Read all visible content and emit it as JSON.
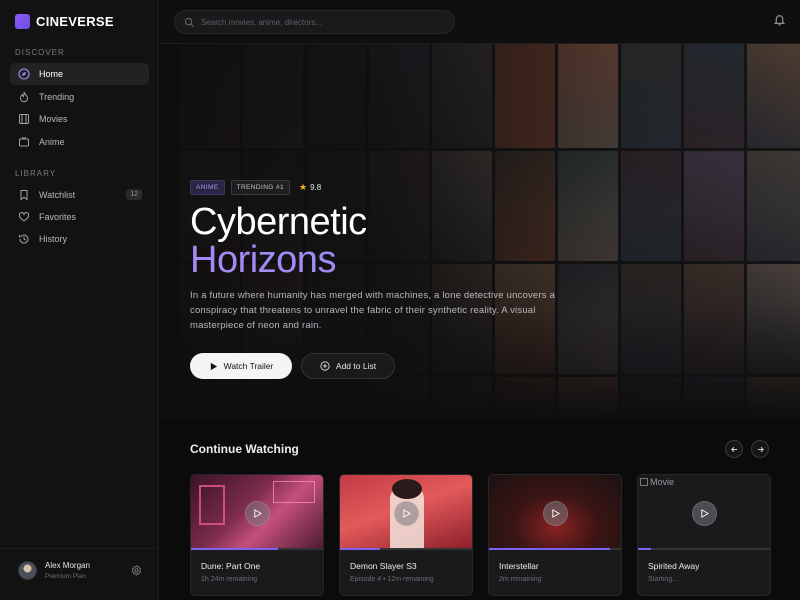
{
  "app": {
    "name": "CINEVERSE",
    "accent": "#8b5cf6"
  },
  "sidebar": {
    "discover_label": "DISCOVER",
    "library_label": "LIBRARY",
    "discover": [
      {
        "label": "Home",
        "icon": "compass-icon",
        "active": true
      },
      {
        "label": "Trending",
        "icon": "flame-icon"
      },
      {
        "label": "Movies",
        "icon": "film-icon"
      },
      {
        "label": "Anime",
        "icon": "tv-icon"
      }
    ],
    "library": [
      {
        "label": "Watchlist",
        "icon": "bookmark-icon",
        "badge": "12"
      },
      {
        "label": "Favorites",
        "icon": "heart-icon"
      },
      {
        "label": "History",
        "icon": "history-icon"
      }
    ],
    "user": {
      "name": "Alex Morgan",
      "plan": "Premium Plan"
    }
  },
  "search": {
    "placeholder": "Search movies, anime, directors..."
  },
  "hero": {
    "genre_tag": "ANIME",
    "trending_tag": "TRENDING #1",
    "rating": "9.8",
    "title_line1": "Cybernetic",
    "title_line2": "Horizons",
    "description": "In a future where humanity has merged with machines, a lone detective uncovers a conspiracy that threatens to unravel the fabric of their synthetic reality. A visual masterpiece of neon and rain.",
    "primary_button": "Watch Trailer",
    "secondary_button": "Add to List",
    "title_accent_color": "#a48af5"
  },
  "continue_watching": {
    "title": "Continue Watching",
    "items": [
      {
        "title": "Dune: Part One",
        "subtitle": "1h 24m remaining",
        "progress": 0.65
      },
      {
        "title": "Demon Slayer S3",
        "subtitle": "Episode 4 • 12m remaining",
        "progress": 0.3
      },
      {
        "title": "Interstellar",
        "subtitle": "2m remaining",
        "progress": 0.9
      },
      {
        "title": "Spirited Away",
        "subtitle": "Starting...",
        "progress": 0.1,
        "broken_image_alt": "Movie"
      }
    ]
  }
}
